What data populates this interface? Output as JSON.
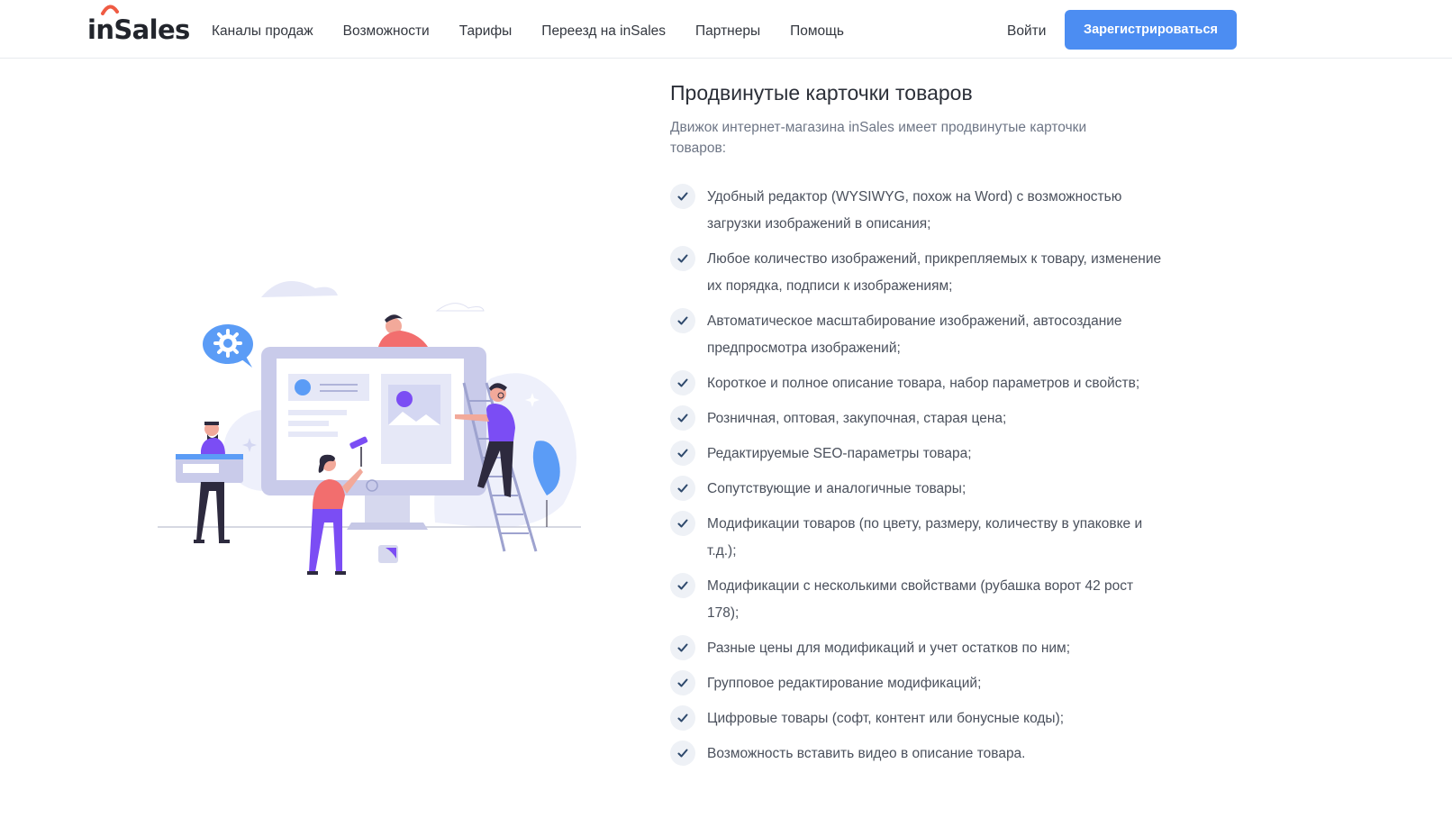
{
  "header": {
    "logo": "inSales",
    "nav": [
      "Каналы продаж",
      "Возможности",
      "Тарифы",
      "Переезд на inSales",
      "Партнеры",
      "Помощь"
    ],
    "login_label": "Войти",
    "signup_label": "Зарегистрироваться"
  },
  "colors": {
    "accent": "#4c8df2",
    "logo_arc": "#ef5b43",
    "illustration_purple": "#7b4df4",
    "illustration_light": "#e8e9f8"
  },
  "content": {
    "title": "Продвинутые карточки товаров",
    "subtitle": "Движок интернет-магазина inSales имеет продвинутые карточки товаров:",
    "features": [
      "Удобный редактор (WYSIWYG, похож на Word) с возможностью загрузки изображений в описания;",
      "Любое количество изображений, прикрепляемых к товару, изменение их порядка, подписи к изображениям;",
      "Автоматическое масштабирование изображений, автосоздание предпросмотра изображений;",
      "Короткое и полное описание товара, набор параметров и свойств;",
      "Розничная, оптовая, закупочная, старая цена;",
      "Редактируемые SEO-параметры товара;",
      "Сопутствующие и аналогичные товары;",
      "Модификации товаров (по цвету, размеру, количеству в упаковке и т.д.);",
      "Модификации с несколькими свойствами (рубашка ворот 42 рост 178);",
      "Разные цены для модификаций и учет остатков по ним;",
      "Групповое редактирование модификаций;",
      "Цифровые товары (софт, контент или бонусные коды);",
      "Возможность вставить видео в описание товара."
    ]
  },
  "icons": {
    "check": "check-icon",
    "gear": "gear-icon"
  }
}
